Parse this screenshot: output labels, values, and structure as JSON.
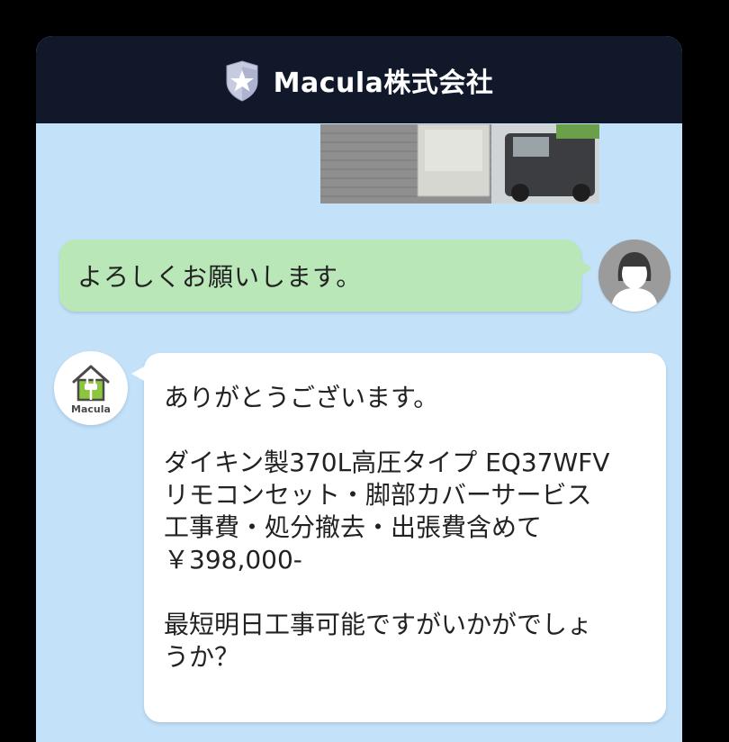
{
  "header": {
    "title": "Macula株式会社",
    "logo_icon": "star-shield-icon"
  },
  "messages": {
    "user": {
      "text": "よろしくお願いします。",
      "avatar_icon": "person-avatar-icon"
    },
    "company": {
      "avatar_icon": "house-plug-logo-icon",
      "brand": "Macula",
      "lines_1": [
        "ありがとうございます。"
      ],
      "lines_2": [
        "ダイキン製370L高圧タイプ EQ37WFV",
        "リモコンセット・脚部カバーサービス",
        "工事費・処分撤去・出張費含めて",
        "￥398,000-"
      ],
      "lines_3": [
        "最短明日工事可能ですがいかがでしょ",
        "うか？"
      ]
    }
  },
  "colors": {
    "header_bg": "#11182a",
    "chat_bg": "#c3e1f9",
    "user_bubble": "#b9e7b8",
    "company_bubble": "#ffffff",
    "logo_green": "#8cc63f"
  }
}
